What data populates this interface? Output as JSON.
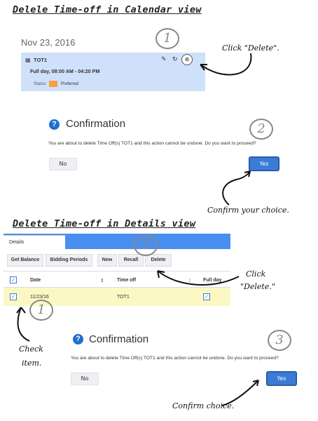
{
  "section1": {
    "title": "Delele Time-off in Calendar view"
  },
  "section2": {
    "title": "Delete Time-off in Details view"
  },
  "calendar": {
    "date": "Nov 23, 2016",
    "event_name": "TOT1",
    "event_time": "Full day, 08:00 AM - 04:20 PM",
    "status_label": "Status:",
    "status_value": "Preferred",
    "status_color": "#f5a142",
    "event_bg": "#cfe0fb"
  },
  "confirm1": {
    "title": "Confirmation",
    "message": "You are about to delete Time Off(s) TOT1 and this action cannot be undone. Do you want to proceed?",
    "no_label": "No",
    "yes_label": "Yes"
  },
  "details": {
    "tab_label": "Details",
    "toolbar": [
      "Get Balance",
      "Bidding Periods",
      "New",
      "Recall",
      "Delete"
    ],
    "columns": [
      "Date",
      "Time off",
      "Full day"
    ],
    "row": {
      "date": "11/23/16",
      "time_off": "TOT1"
    },
    "header_color": "#4a8ef0",
    "row_bg": "#fbf8c4"
  },
  "confirm2": {
    "title": "Confirmation",
    "message": "You are about to delete Time Off(s) TOT1 and this action cannot be undone. Do you want to proceed?",
    "no_label": "No",
    "yes_label": "Yes"
  },
  "annotations": {
    "click_delete_1": "Click \"Delete\".",
    "confirm_choice_1": "Confirm your choice.",
    "click_2a": "Click",
    "click_2b": "\"Delete.\"",
    "check_a": "Check",
    "check_b": "item.",
    "confirm_choice_2": "Confirm choice.",
    "step1": "1",
    "step2": "2",
    "step3": "3"
  },
  "icons": [
    "edit-icon",
    "recall-icon",
    "delete-icon",
    "calendar-icon",
    "question-icon",
    "sort-icon",
    "checkbox-icon"
  ]
}
